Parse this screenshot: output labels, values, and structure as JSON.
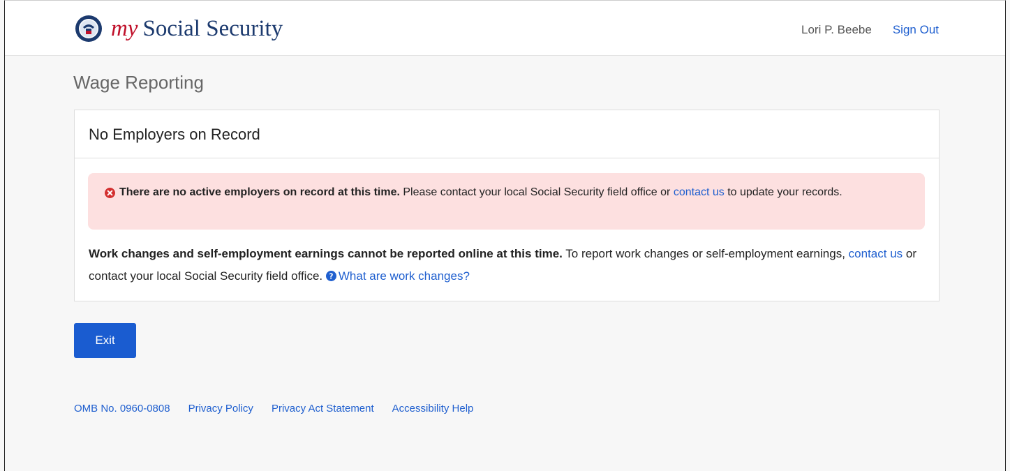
{
  "header": {
    "brand_prefix": "my",
    "brand_name": "Social Security",
    "user_name": "Lori P. Beebe",
    "sign_out": "Sign Out"
  },
  "page": {
    "title": "Wage Reporting"
  },
  "panel": {
    "title": "No Employers on Record",
    "alert": {
      "icon": "error-circle-icon",
      "bold": "There are no active employers on record at this time.",
      "text_before_link": " Please contact your local Social Security field office or ",
      "link": "contact us",
      "text_after_link": " to update your records."
    },
    "notice": {
      "bold": "Work changes and self-employment earnings cannot be reported online at this time.",
      "text1": " To report work changes or self-employment earnings, ",
      "link1": "contact us",
      "text2": " or contact your local Social Security field office. ",
      "help_icon": "question-circle-icon",
      "help_link": "What are work changes?"
    }
  },
  "actions": {
    "exit": "Exit"
  },
  "footer": {
    "links": [
      "OMB No. 0960-0808",
      "Privacy Policy",
      "Privacy Act Statement",
      "Accessibility Help"
    ]
  },
  "colors": {
    "brand_red": "#c0102a",
    "brand_navy": "#1c3a6e",
    "link": "#1f5fcf",
    "button": "#1a5cd0",
    "alert_bg": "#fde0e0",
    "alert_icon": "#d32f2f"
  }
}
